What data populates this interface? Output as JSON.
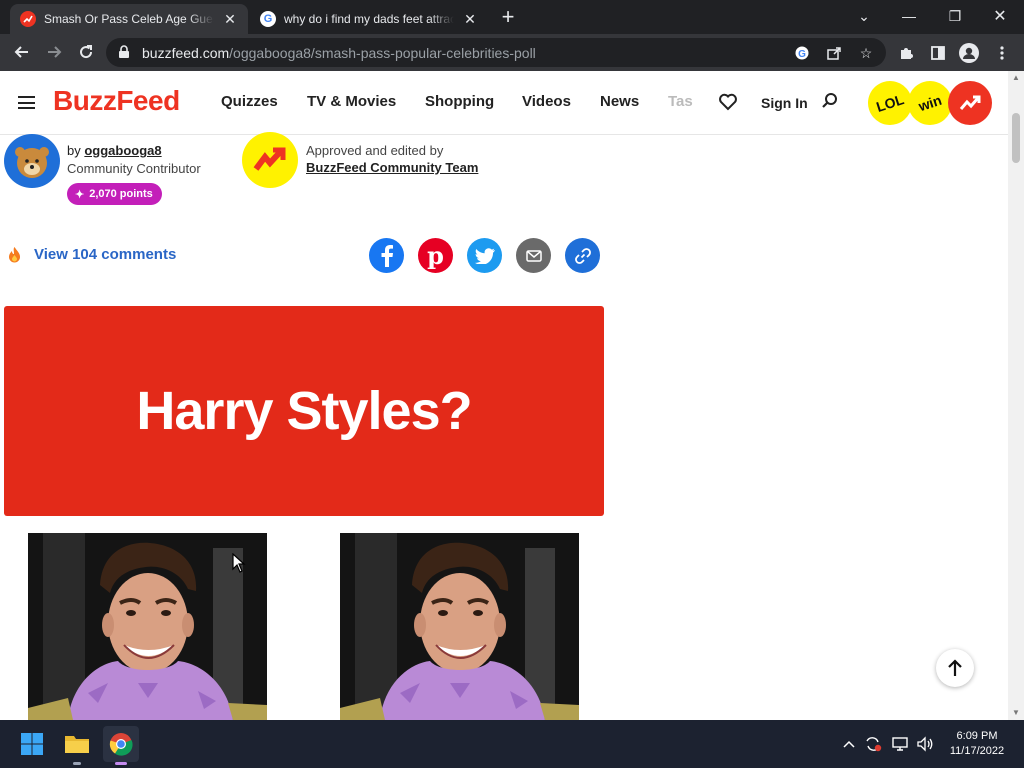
{
  "browser": {
    "tabs": [
      {
        "title": "Smash Or Pass Celeb Age Guessing",
        "active": true
      },
      {
        "title": "why do i find my dads feet attractive",
        "active": false
      }
    ],
    "url_host": "buzzfeed.com",
    "url_path": "/oggabooga8/smash-pass-popular-celebrities-poll"
  },
  "site": {
    "logo": "BuzzFeed",
    "nav": [
      "Quizzes",
      "TV & Movies",
      "Shopping",
      "Videos",
      "News",
      "Tas"
    ],
    "signin": "Sign In",
    "badges": {
      "lol": "LOL",
      "win": "win"
    }
  },
  "byline": {
    "by": "by",
    "author": "oggabooga8",
    "role": "Community Contributor",
    "points": "2,070 points",
    "approved_label": "Approved and edited by",
    "approved_team": "BuzzFeed Community Team"
  },
  "comments_link": "View 104 comments",
  "share": [
    "facebook",
    "pinterest",
    "twitter",
    "email",
    "link"
  ],
  "hero_text": "Harry Styles?",
  "taskbar": {
    "time": "6:09 PM",
    "date": "11/17/2022"
  }
}
